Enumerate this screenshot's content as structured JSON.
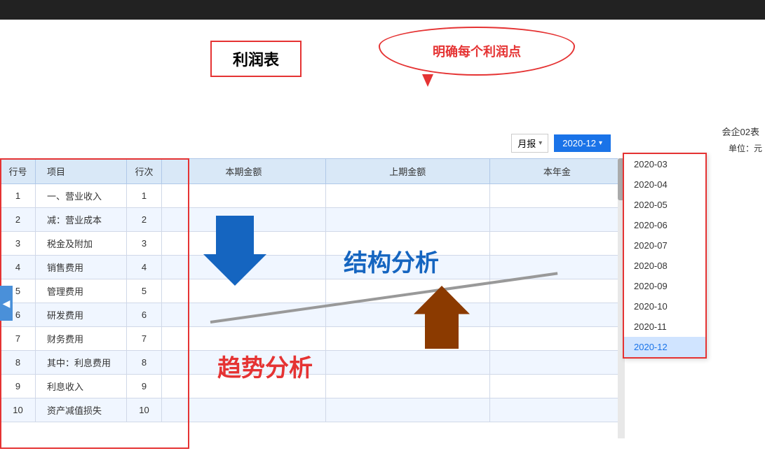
{
  "topBar": {},
  "callout": {
    "text": "明确每个利润点"
  },
  "titleBox": {
    "text": "利润表"
  },
  "topRightLabel": "会企02表",
  "unitLabel": "单位：元",
  "controls": {
    "periodLabel": "月报",
    "selectedDate": "2020-12"
  },
  "dropdown": {
    "items": [
      "2020-03",
      "2020-04",
      "2020-05",
      "2020-06",
      "2020-07",
      "2020-08",
      "2020-09",
      "2020-10",
      "2020-11",
      "2020-12"
    ],
    "selected": "2020-12"
  },
  "table": {
    "headers": [
      "行号",
      "项目",
      "行次",
      "本期金额",
      "上期金额",
      "本年金"
    ],
    "rows": [
      {
        "id": 1,
        "name": "一、营业收入",
        "order": "1",
        "current": "",
        "last": "",
        "year": ""
      },
      {
        "id": 2,
        "name": "减：营业成本",
        "order": "2",
        "current": "",
        "last": "",
        "year": ""
      },
      {
        "id": 3,
        "name": "税金及附加",
        "order": "3",
        "current": "",
        "last": "",
        "year": ""
      },
      {
        "id": 4,
        "name": "销售费用",
        "order": "4",
        "current": "",
        "last": "",
        "year": ""
      },
      {
        "id": 5,
        "name": "管理费用",
        "order": "5",
        "current": "",
        "last": "",
        "year": ""
      },
      {
        "id": 6,
        "name": "研发费用",
        "order": "6",
        "current": "",
        "last": "",
        "year": ""
      },
      {
        "id": 7,
        "name": "财务费用",
        "order": "7",
        "current": "",
        "last": "",
        "year": ""
      },
      {
        "id": 8,
        "name": "其中：利息费用",
        "order": "8",
        "current": "",
        "last": "",
        "year": ""
      },
      {
        "id": 9,
        "name": "利息收入",
        "order": "9",
        "current": "",
        "last": "",
        "year": ""
      },
      {
        "id": 10,
        "name": "资产减值损失",
        "order": "10",
        "current": "",
        "last": "",
        "year": ""
      }
    ]
  },
  "overlays": {
    "structureAnalysis": "结构分析",
    "trendAnalysis": "趋势分析"
  }
}
